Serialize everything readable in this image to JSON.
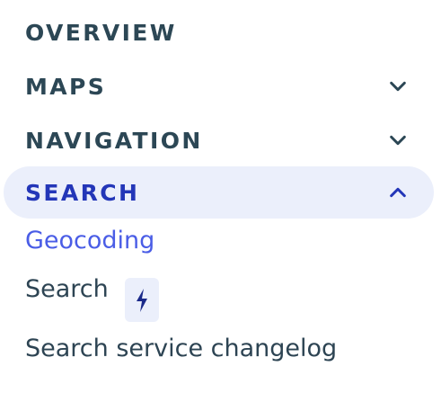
{
  "sidebar": {
    "sections": [
      {
        "label": "OVERVIEW",
        "chevron": "none",
        "active": false
      },
      {
        "label": "MAPS",
        "chevron": "chevron-down-icon",
        "active": false
      },
      {
        "label": "NAVIGATION",
        "chevron": "chevron-down-icon",
        "active": false
      },
      {
        "label": "SEARCH",
        "chevron": "chevron-up-icon",
        "active": true
      }
    ],
    "search_items": [
      {
        "label": "Geocoding",
        "current": true
      },
      {
        "label": "Search",
        "badge_icon": "lightning-bolt-icon"
      },
      {
        "label": "Search service changelog"
      }
    ]
  },
  "colors": {
    "section_text": "#2c4755",
    "active_text": "#2336b8",
    "active_bg": "#ebeffb",
    "link_current": "#4a5de6",
    "bolt": "#1b2a8a"
  }
}
